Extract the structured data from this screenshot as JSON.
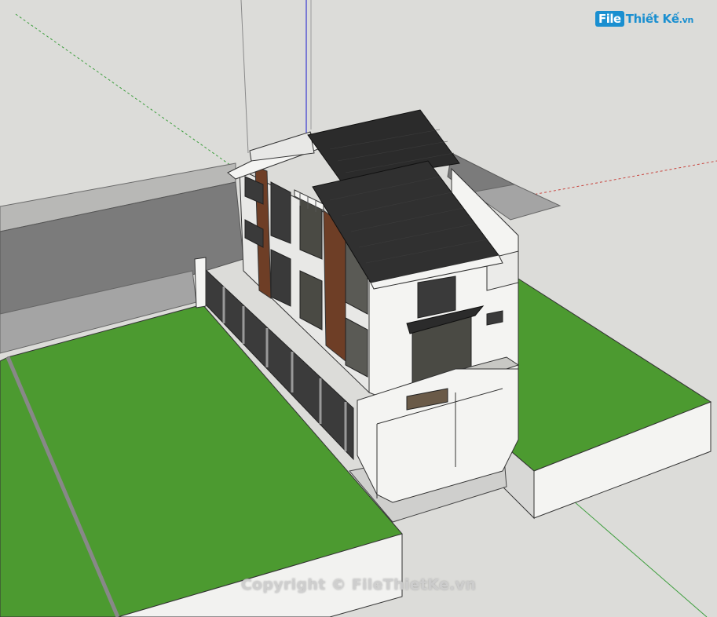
{
  "logo": {
    "badge": "File",
    "name": "Thiết Kế",
    "tld": ".vn"
  },
  "watermark": {
    "text": "Copyright © FileThietKe.vn"
  },
  "colors": {
    "background": "#dcdcd9",
    "grass": "#4c9a30",
    "road": "#7b7b7b",
    "sidewalk": "#a4a4a4",
    "roof": "#2b2b2b",
    "wood": "#6e3e26",
    "wall": "#f4f4f2",
    "axis_red": "#c8453f",
    "axis_green": "#3f9f3f",
    "axis_blue": "#3a3ad0",
    "logo_blue": "#1a8fd0"
  }
}
